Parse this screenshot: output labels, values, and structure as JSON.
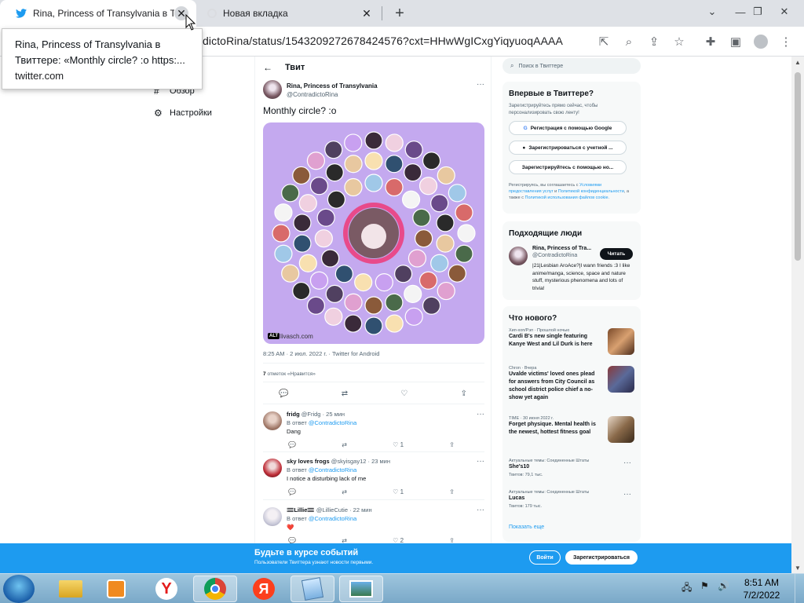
{
  "browser": {
    "active_tab": {
      "title": "Rina, Princess of Transylvania в Т",
      "close": "✕"
    },
    "inactive_tab": {
      "title": "Новая вкладка",
      "close": "✕"
    },
    "new_tab": "+",
    "url_domain_part": "dictoRina/status/1543209272678424576?cxt=HHwWgICxgYiqyuoqAAAA",
    "tooltip": {
      "line1": "Rina, Princess of Transylvania в",
      "line2": "Твиттере: «Monthly circle? :o https:...",
      "line3": "twitter.com"
    }
  },
  "leftnav": {
    "items": [
      {
        "label": "Обзор",
        "icon": "#"
      },
      {
        "label": "Настройки",
        "icon": "⚙"
      }
    ]
  },
  "tweet": {
    "header": "Твит",
    "back": "←",
    "author_name": "Rina, Princess of Transylvania",
    "author_handle": "@ContradictoRina",
    "more": "···",
    "text": "Monthly circle? :o",
    "alt": "ALT",
    "watermark": "livasch.com",
    "meta": "8:25 AM · 2 июл. 2022 г. · Twitter for Android",
    "likes_count": "7",
    "likes_label": "отметок «Нравится»",
    "actions": [
      "💬",
      "⇄",
      "♡",
      "⇪"
    ]
  },
  "replies": [
    {
      "name": "fridg",
      "handle": "@Fridg",
      "time": "· 25 мин",
      "reply_to_prefix": "В ответ",
      "reply_to": "@ContradictoRina",
      "text": "Dang",
      "likes": "1"
    },
    {
      "name": "sky loves frogs",
      "handle": "@skyisgay12",
      "time": "· 23 мин",
      "reply_to_prefix": "В ответ",
      "reply_to": "@ContradictoRina",
      "text": "I notice a disturbing lack of me",
      "likes": "1"
    },
    {
      "name": "🟰Lillie🟰",
      "handle": "@LillieCutie",
      "time": "· 22 мин",
      "reply_to_prefix": "В ответ",
      "reply_to": "@ContradictoRina",
      "text": "❤️",
      "likes": "2"
    }
  ],
  "sidebar": {
    "search_placeholder": "Поиск в Твиттере",
    "signup_card": {
      "title": "Впервые в Твиттере?",
      "subtitle": "Зарегистрируйтесь прямо сейчас, чтобы персонализировать свою ленту!",
      "google": "Регистрация с помощью Google",
      "apple": "Зарегистрироваться с учетной ...",
      "other": "Зарегистрируйтесь с помощью но...",
      "terms_prefix": "Регистрируясь, вы соглашаетесь с",
      "terms_link1": "Условиями предоставления услуг",
      "terms_and": "и",
      "terms_link2": "Политикой конфиденциальности",
      "terms_also": ", а также с",
      "terms_link3": "Политикой использования файлов cookie."
    },
    "people_card": {
      "title": "Подходящие люди",
      "name": "Rina, Princess of Tra...",
      "handle": "@ContradictoRina",
      "follow": "Читать",
      "bio": "|21|Lesbian AroAce?|I wann friends :3 I like anime/manga, science, space and nature stuff, mysterious phenomena and lots of trivia!"
    },
    "trends_card": {
      "title": "Что нового?",
      "items": [
        {
          "category": "Хип-хоп/Рэп · Прошлой ночью",
          "title": "Cardi B's new single featuring Kanye West and Lil Durk is here"
        },
        {
          "category": "Chron · Вчера",
          "title": "Uvalde victims' loved ones plead for answers from City Council as school district police chief a no-show yet again"
        },
        {
          "category": "TIME · 30 июня 2022 г.",
          "title": "Forget physique. Mental health is the newest, hottest fitness goal"
        },
        {
          "category": "Актуальные темы: Соединенные Штаты",
          "title": "She's10",
          "count": "Твитов: 79,1 тыс."
        },
        {
          "category": "Актуальные темы: Соединенные Штаты",
          "title": "Lucas",
          "count": "Твитов: 179 тыс."
        }
      ],
      "show_more": "Показать еще"
    }
  },
  "banner": {
    "title": "Будьте в курсе событий",
    "subtitle": "Пользователи Твиттера узнают новости первыми.",
    "login": "Войти",
    "signup": "Зарегистрироваться"
  },
  "taskbar": {
    "time": "8:51 AM",
    "date": "7/2/2022"
  },
  "colors": {
    "twitter_blue": "#1d9bf0",
    "image_bg": "#c4a9ef"
  }
}
